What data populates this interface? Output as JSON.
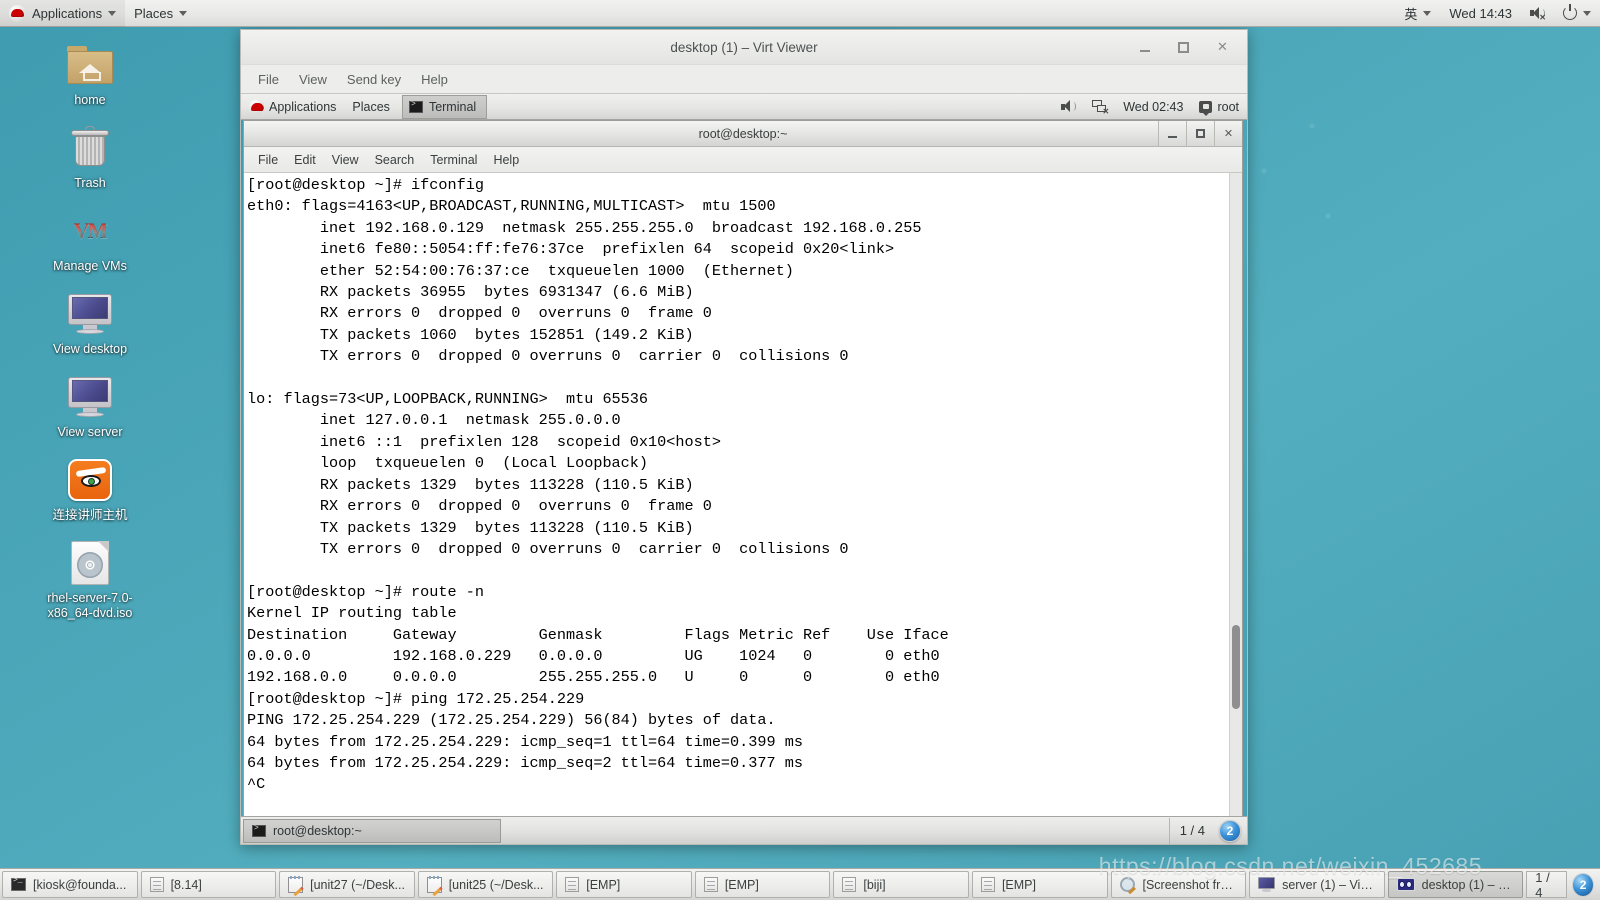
{
  "host_panel": {
    "logo_icon": "redhat-logo-icon",
    "applications_label": "Applications",
    "places_label": "Places",
    "input_method": "英",
    "clock": "Wed 14:43",
    "volume_icon": "volume-muted-icon",
    "power_icon": "power-icon"
  },
  "desktop_icons": [
    {
      "label": "home",
      "icon": "home-folder-icon"
    },
    {
      "label": "Trash",
      "icon": "trash-icon"
    },
    {
      "label": "Manage VMs",
      "icon": "virt-manager-icon"
    },
    {
      "label": "View desktop",
      "icon": "monitor-icon"
    },
    {
      "label": "View server",
      "icon": "monitor-icon"
    },
    {
      "label": "连接讲师主机",
      "icon": "vnc-fox-icon"
    },
    {
      "label": "rhel-server-7.0-x86_64-dvd.iso",
      "icon": "iso-disc-icon"
    }
  ],
  "virt_viewer": {
    "title": "desktop (1) – Virt Viewer",
    "menus": [
      "File",
      "View",
      "Send key",
      "Help"
    ],
    "window_buttons": {
      "minimize": "–",
      "maximize": "❐",
      "close": "✕"
    }
  },
  "guest_top_panel": {
    "applications_label": "Applications",
    "places_label": "Places",
    "active_task": "Terminal",
    "volume_icon": "volume-icon",
    "network_icon": "network-disconnected-icon",
    "clock": "Wed 02:43",
    "user_icon": "user-icon",
    "user_label": "root"
  },
  "terminal": {
    "title": "root@desktop:~",
    "menus": [
      "File",
      "Edit",
      "View",
      "Search",
      "Terminal",
      "Help"
    ],
    "window_buttons": {
      "minimize": "–",
      "maximize": "❐",
      "close": "✕"
    },
    "content": "[root@desktop ~]# ifconfig\neth0: flags=4163<UP,BROADCAST,RUNNING,MULTICAST>  mtu 1500\n        inet 192.168.0.129  netmask 255.255.255.0  broadcast 192.168.0.255\n        inet6 fe80::5054:ff:fe76:37ce  prefixlen 64  scopeid 0x20<link>\n        ether 52:54:00:76:37:ce  txqueuelen 1000  (Ethernet)\n        RX packets 36955  bytes 6931347 (6.6 MiB)\n        RX errors 0  dropped 0  overruns 0  frame 0\n        TX packets 1060  bytes 152851 (149.2 KiB)\n        TX errors 0  dropped 0 overruns 0  carrier 0  collisions 0\n\nlo: flags=73<UP,LOOPBACK,RUNNING>  mtu 65536\n        inet 127.0.0.1  netmask 255.0.0.0\n        inet6 ::1  prefixlen 128  scopeid 0x10<host>\n        loop  txqueuelen 0  (Local Loopback)\n        RX packets 1329  bytes 113228 (110.5 KiB)\n        RX errors 0  dropped 0  overruns 0  frame 0\n        TX packets 1329  bytes 113228 (110.5 KiB)\n        TX errors 0  dropped 0 overruns 0  carrier 0  collisions 0\n\n[root@desktop ~]# route -n\nKernel IP routing table\nDestination     Gateway         Genmask         Flags Metric Ref    Use Iface\n0.0.0.0         192.168.0.229   0.0.0.0         UG    1024   0        0 eth0\n192.168.0.0     0.0.0.0         255.255.255.0   U     0      0        0 eth0\n[root@desktop ~]# ping 172.25.254.229\nPING 172.25.254.229 (172.25.254.229) 56(84) bytes of data.\n64 bytes from 172.25.254.229: icmp_seq=1 ttl=64 time=0.399 ms\n64 bytes from 172.25.254.229: icmp_seq=2 ttl=64 time=0.377 ms\n^C"
  },
  "guest_bottom_panel": {
    "task_label": "root@desktop:~",
    "workspace": "1 / 4",
    "orb_label": "2"
  },
  "host_taskbar": {
    "items": [
      {
        "label": "[kiosk@founda...",
        "icon": "terminal-icon",
        "active": false
      },
      {
        "label": "[8.14]",
        "icon": "document-icon",
        "active": false
      },
      {
        "label": "[unit27 (~/Desk...",
        "icon": "text-editor-icon",
        "active": false
      },
      {
        "label": "[unit25 (~/Desk...",
        "icon": "text-editor-icon",
        "active": false
      },
      {
        "label": "[EMP]",
        "icon": "document-icon",
        "active": false
      },
      {
        "label": "[EMP]",
        "icon": "document-icon",
        "active": false
      },
      {
        "label": "[biji]",
        "icon": "document-icon",
        "active": false
      },
      {
        "label": "[EMP]",
        "icon": "document-icon",
        "active": false
      },
      {
        "label": "[Screenshot fro...",
        "icon": "screenshot-icon",
        "active": false
      },
      {
        "label": "server (1) – Virt...",
        "icon": "monitor-icon",
        "active": false
      },
      {
        "label": "desktop (1) – V...",
        "icon": "virt-viewer-icon",
        "active": true
      }
    ],
    "workspace": "1 / 4",
    "orb_label": "2"
  },
  "watermark": "https://blog.csdn.net/weixin_452685",
  "colors": {
    "wallpaper": "#4aa6b8",
    "panel": "#e8e8e6",
    "accent": "#cc0000",
    "terminal_bg": "#ffffff",
    "terminal_fg": "#000000"
  }
}
